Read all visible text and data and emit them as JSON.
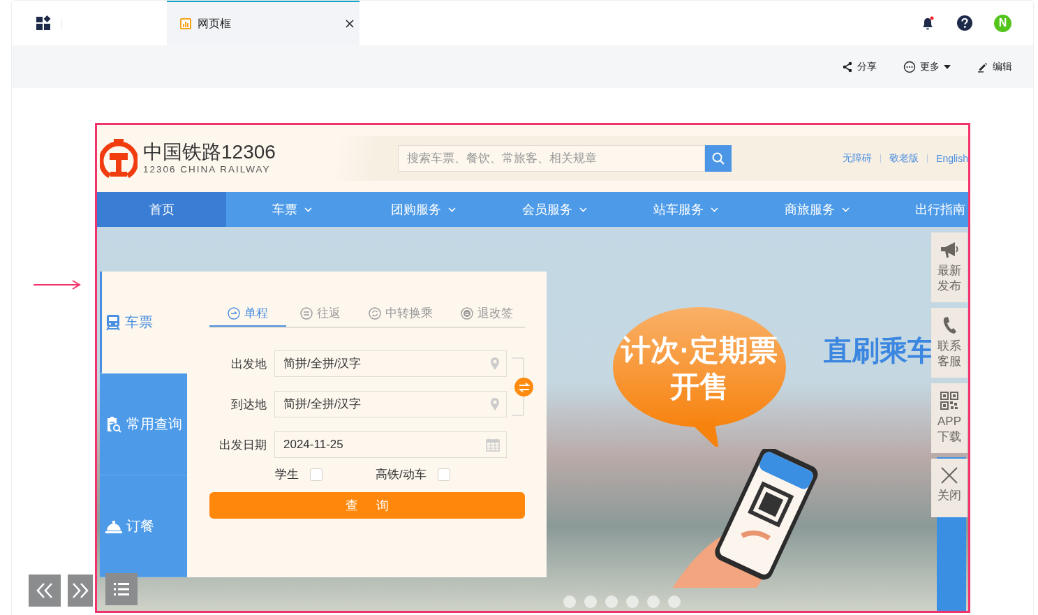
{
  "app_tab": {
    "title": "网页框",
    "selected": true
  },
  "toolbar": [
    {
      "kind": "share",
      "label": "分享"
    },
    {
      "kind": "more",
      "label": "更多"
    },
    {
      "kind": "edit",
      "label": "编辑"
    }
  ],
  "avatar": {
    "letter": "N"
  },
  "site": {
    "logo_title": "中国铁路12306",
    "logo_subtitle": "12306 CHINA RAILWAY",
    "search": {
      "placeholder": "搜索车票、餐饮、常旅客、相关规章"
    },
    "links": [
      "无障碍",
      "敬老版",
      "English"
    ]
  },
  "nav": [
    {
      "label": "首页",
      "selected": true,
      "dropdown": false
    },
    {
      "label": "车票",
      "selected": false,
      "dropdown": true
    },
    {
      "label": "团购服务",
      "selected": false,
      "dropdown": true
    },
    {
      "label": "会员服务",
      "selected": false,
      "dropdown": true
    },
    {
      "label": "站车服务",
      "selected": false,
      "dropdown": true
    },
    {
      "label": "商旅服务",
      "selected": false,
      "dropdown": true
    },
    {
      "label": "出行指南",
      "selected": false,
      "dropdown": false
    }
  ],
  "booking": {
    "side_tabs": [
      {
        "kind": "ticket",
        "label": "车票",
        "selected": true
      },
      {
        "kind": "query",
        "label": "常用查询",
        "selected": false
      },
      {
        "kind": "meal",
        "label": "订餐",
        "selected": false
      }
    ],
    "trip_tabs": [
      {
        "kind": "oneway",
        "label": "单程",
        "selected": true
      },
      {
        "kind": "round",
        "label": "往返",
        "selected": false
      },
      {
        "kind": "transfer",
        "label": "中转换乘",
        "selected": false
      },
      {
        "kind": "refund",
        "label": "退改签",
        "selected": false
      }
    ],
    "fields": [
      {
        "kind": "location",
        "label": "出发地",
        "placeholder": "简拼/全拼/汉字"
      },
      {
        "kind": "location",
        "label": "到达地",
        "placeholder": "简拼/全拼/汉字"
      },
      {
        "kind": "date",
        "label": "出发日期",
        "value": "2024-11-25"
      }
    ],
    "checkboxes": [
      {
        "label": "学生",
        "checked": false
      },
      {
        "label": "高铁/动车",
        "checked": false
      }
    ],
    "submit": "查询"
  },
  "banner": {
    "bubble_lines": [
      "计次·定期票",
      "开售"
    ],
    "slogan": "直刷乘车"
  },
  "side_panel": [
    {
      "kind": "announce",
      "lines": [
        "最新",
        "发布"
      ]
    },
    {
      "kind": "phone",
      "lines": [
        "联系",
        "客服"
      ]
    },
    {
      "kind": "qr",
      "lines": [
        "APP",
        "下载"
      ]
    },
    {
      "kind": "close",
      "lines": [
        "关闭"
      ]
    }
  ]
}
